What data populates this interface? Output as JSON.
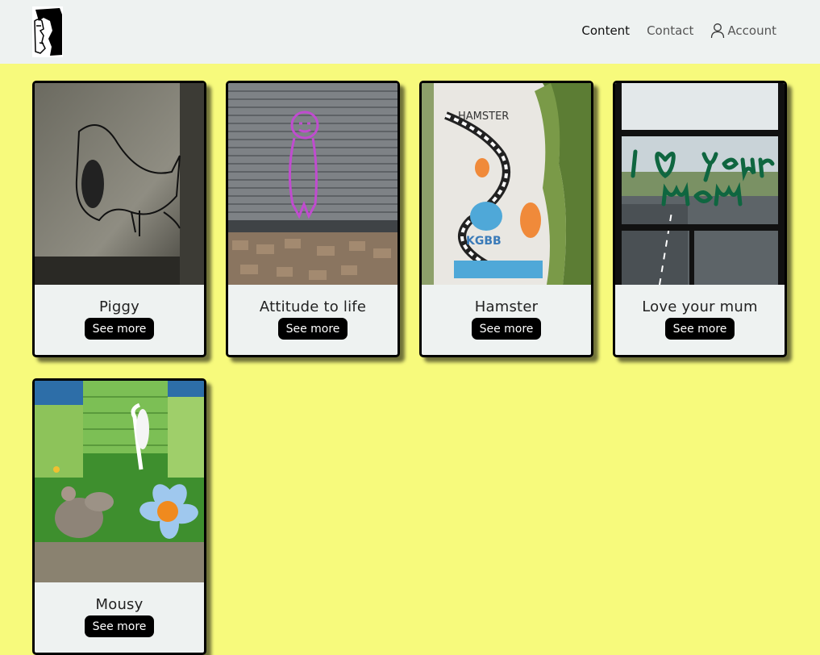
{
  "nav": {
    "links": [
      "Content",
      "Contact"
    ],
    "account_label": "Account"
  },
  "cards": [
    {
      "title": "Piggy",
      "button": "See more"
    },
    {
      "title": "Attitude to life",
      "button": "See more"
    },
    {
      "title": "Hamster",
      "button": "See more"
    },
    {
      "title": "Love your mum",
      "button": "See more"
    },
    {
      "title": "Mousy",
      "button": "See more"
    }
  ],
  "colors": {
    "background": "#f7fa7c",
    "navbar": "#eef2f1",
    "card": "#eef2f1",
    "button": "#000000"
  }
}
